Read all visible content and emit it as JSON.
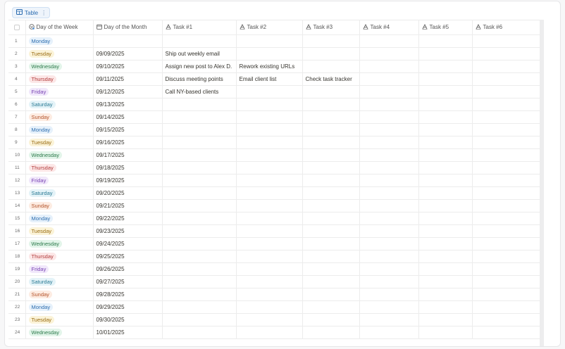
{
  "view": {
    "label": "Table",
    "icon": "table-icon"
  },
  "columns": [
    {
      "label": "",
      "icon": "checkbox-icon"
    },
    {
      "label": "Day of the Week",
      "icon": "select-status-icon"
    },
    {
      "label": "Day of the Month",
      "icon": "calendar-icon"
    },
    {
      "label": "Task #1",
      "icon": "text-type-icon"
    },
    {
      "label": "Task #2",
      "icon": "text-type-icon"
    },
    {
      "label": "Task #3",
      "icon": "text-type-icon"
    },
    {
      "label": "Task #4",
      "icon": "text-type-icon"
    },
    {
      "label": "Task #5",
      "icon": "text-type-icon"
    },
    {
      "label": "Task #6",
      "icon": "text-type-icon"
    }
  ],
  "rows": [
    {
      "n": "1",
      "day": "Monday",
      "date": "",
      "t1": "",
      "t2": "",
      "t3": ""
    },
    {
      "n": "2",
      "day": "Tuesday",
      "date": "09/09/2025",
      "t1": "Ship out weekly email",
      "t2": "",
      "t3": ""
    },
    {
      "n": "3",
      "day": "Wednesday",
      "date": "09/10/2025",
      "t1": "Assign new post to Alex D.",
      "t2": "Rework existing URLs",
      "t3": ""
    },
    {
      "n": "4",
      "day": "Thursday",
      "date": "09/11/2025",
      "t1": "Discuss meeting points",
      "t2": "Email client list",
      "t3": "Check task tracker"
    },
    {
      "n": "5",
      "day": "Friday",
      "date": "09/12/2025",
      "t1": "Call NY-based clients",
      "t2": "",
      "t3": ""
    },
    {
      "n": "6",
      "day": "Saturday",
      "date": "09/13/2025",
      "t1": "",
      "t2": "",
      "t3": ""
    },
    {
      "n": "7",
      "day": "Sunday",
      "date": "09/14/2025",
      "t1": "",
      "t2": "",
      "t3": ""
    },
    {
      "n": "8",
      "day": "Monday",
      "date": "09/15/2025",
      "t1": "",
      "t2": "",
      "t3": ""
    },
    {
      "n": "9",
      "day": "Tuesday",
      "date": "09/16/2025",
      "t1": "",
      "t2": "",
      "t3": ""
    },
    {
      "n": "10",
      "day": "Wednesday",
      "date": "09/17/2025",
      "t1": "",
      "t2": "",
      "t3": ""
    },
    {
      "n": "11",
      "day": "Thursday",
      "date": "09/18/2025",
      "t1": "",
      "t2": "",
      "t3": ""
    },
    {
      "n": "12",
      "day": "Friday",
      "date": "09/19/2025",
      "t1": "",
      "t2": "",
      "t3": ""
    },
    {
      "n": "13",
      "day": "Saturday",
      "date": "09/20/2025",
      "t1": "",
      "t2": "",
      "t3": ""
    },
    {
      "n": "14",
      "day": "Sunday",
      "date": "09/21/2025",
      "t1": "",
      "t2": "",
      "t3": ""
    },
    {
      "n": "15",
      "day": "Monday",
      "date": "09/22/2025",
      "t1": "",
      "t2": "",
      "t3": ""
    },
    {
      "n": "16",
      "day": "Tuesday",
      "date": "09/23/2025",
      "t1": "",
      "t2": "",
      "t3": ""
    },
    {
      "n": "17",
      "day": "Wednesday",
      "date": "09/24/2025",
      "t1": "",
      "t2": "",
      "t3": ""
    },
    {
      "n": "18",
      "day": "Thursday",
      "date": "09/25/2025",
      "t1": "",
      "t2": "",
      "t3": ""
    },
    {
      "n": "19",
      "day": "Friday",
      "date": "09/26/2025",
      "t1": "",
      "t2": "",
      "t3": ""
    },
    {
      "n": "20",
      "day": "Saturday",
      "date": "09/27/2025",
      "t1": "",
      "t2": "",
      "t3": ""
    },
    {
      "n": "21",
      "day": "Sunday",
      "date": "09/28/2025",
      "t1": "",
      "t2": "",
      "t3": ""
    },
    {
      "n": "22",
      "day": "Monday",
      "date": "09/29/2025",
      "t1": "",
      "t2": "",
      "t3": ""
    },
    {
      "n": "23",
      "day": "Tuesday",
      "date": "09/30/2025",
      "t1": "",
      "t2": "",
      "t3": ""
    },
    {
      "n": "24",
      "day": "Wednesday",
      "date": "10/01/2025",
      "t1": "",
      "t2": "",
      "t3": ""
    }
  ],
  "tag_colors": {
    "Monday": "#2f6fb0",
    "Tuesday": "#9a6c12",
    "Wednesday": "#2c7a4b",
    "Thursday": "#b23a3a",
    "Friday": "#7a45b4",
    "Saturday": "#2a7a94",
    "Sunday": "#b4532a"
  }
}
